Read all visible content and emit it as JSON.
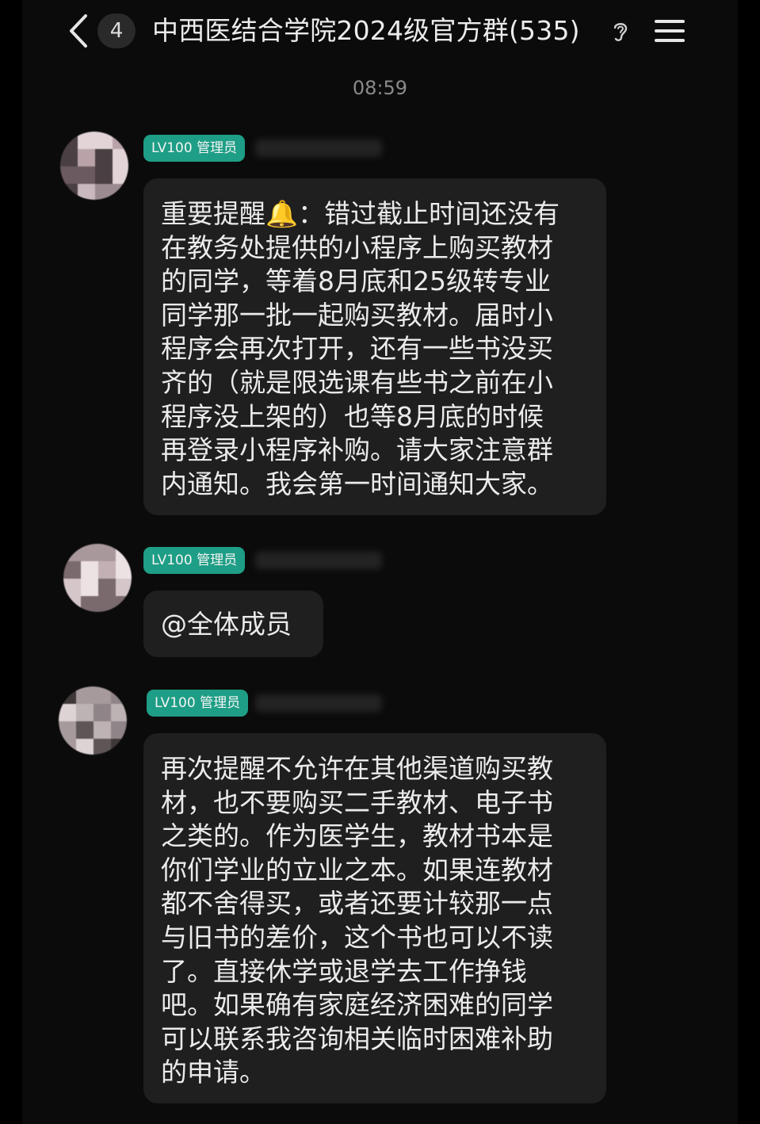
{
  "header": {
    "back_label": "<",
    "unread_count": "4",
    "title": "中西医结合学院2024级官方群(535)",
    "ear_icon": "ear-icon",
    "menu_icon": "menu-icon"
  },
  "timestamp": "08:59",
  "messages": [
    {
      "tag": "LV100 管理员",
      "lines": [
        "重要提醒🔔：错过截止时间还没有",
        "在教务处提供的小程序上购买教材",
        "的同学，等着8月底和25级转专业",
        "同学那一批一起购买教材。届时小",
        "程序会再次打开，还有一些书没买",
        "齐的（就是限选课有些书之前在小",
        "程序没上架的）也等8月底的时候",
        "再登录小程序补购。请大家注意群",
        "内通知。我会第一时间通知大家。"
      ]
    },
    {
      "tag": "LV100 管理员",
      "lines": [
        "@全体成员"
      ]
    },
    {
      "tag": "LV100 管理员",
      "lines": [
        "再次提醒不允许在其他渠道购买教",
        "材，也不要购买二手教材、电子书",
        "之类的。作为医学生，教材书本是",
        "你们学业的立业之本。如果连教材",
        "都不舍得买，或者还要计较那一点",
        "与旧书的差价，这个书也可以不读",
        "了。直接休学或退学去工作挣钱",
        "吧。如果确有家庭经济困难的同学",
        "可以联系我咨询相关临时困难补助",
        "的申请。"
      ]
    }
  ],
  "colors": {
    "background": "#000000",
    "bubble": "#1f1f1f",
    "tag": "#1e9e86",
    "text": "#ebebeb",
    "timestamp": "#8a8a8a"
  }
}
